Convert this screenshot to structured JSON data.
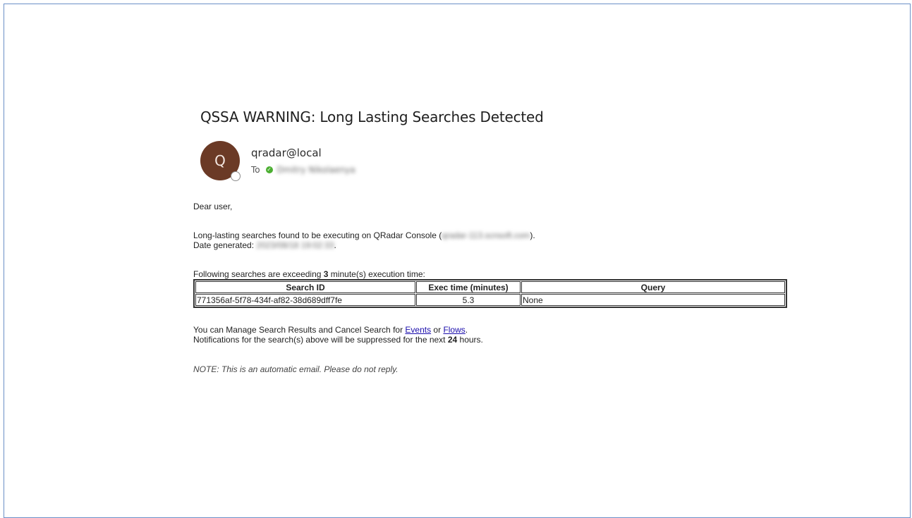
{
  "email": {
    "subject": "QSSA WARNING: Long Lasting Searches Detected",
    "avatar_initial": "Q",
    "sender": "qradar@local",
    "to_label": "To",
    "recipient": "Dmitry Nikolaenya"
  },
  "body": {
    "greeting": "Dear user,",
    "line1_prefix": "Long-lasting searches found to be executing on QRadar Console (",
    "console_host": "qradar-113.scnsoft.com",
    "line1_suffix": ").",
    "date_label": "Date generated: ",
    "date_value": "2023/08/18 19:02:33",
    "date_suffix": ".",
    "exceeding_prefix": "Following searches are exceeding ",
    "exceeding_value": "3",
    "exceeding_suffix": " minute(s) execution time:",
    "manage_prefix": "You can Manage Search Results and Cancel Search for ",
    "events_link": "Events",
    "or_text": " or ",
    "flows_link": "Flows",
    "manage_suffix": ".",
    "suppress_prefix": "Notifications for the search(s) above will be suppressed for the next ",
    "suppress_value": "24",
    "suppress_suffix": " hours.",
    "note": "NOTE: This is an automatic email. Please do not reply."
  },
  "table": {
    "headers": [
      "Search ID",
      "Exec time (minutes)",
      "Query"
    ],
    "rows": [
      [
        "771356af-5f78-434f-af82-38d689dff7fe",
        "5.3",
        "None"
      ]
    ]
  },
  "colors": {
    "avatar_bg": "#6b3a26",
    "frame_border": "#6b8fc7",
    "link": "#1a0dab",
    "presence_ok": "#4caf32"
  }
}
